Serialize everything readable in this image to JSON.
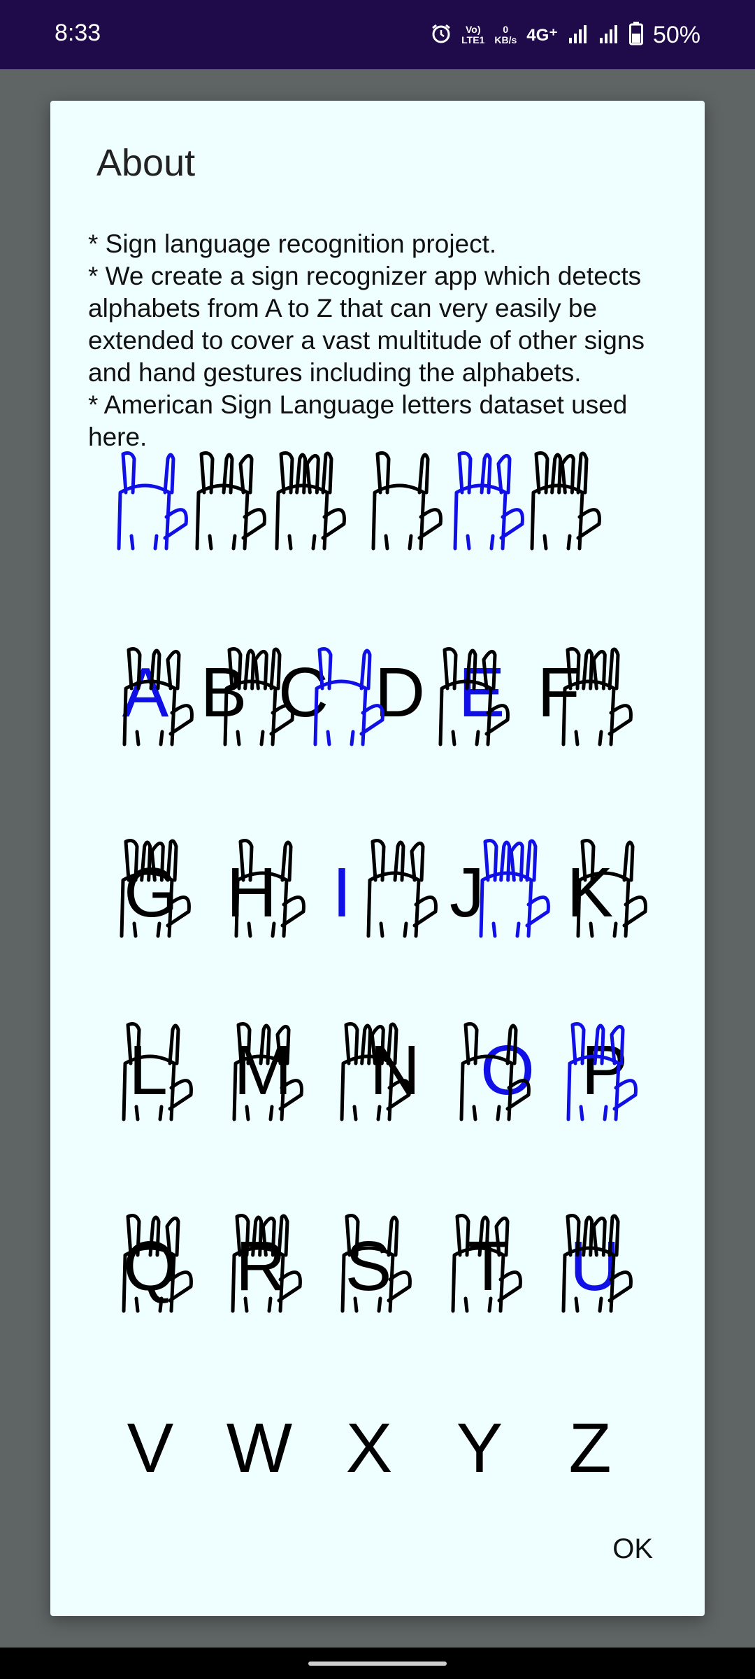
{
  "status_bar": {
    "time": "8:33",
    "icons": [
      "alarm-icon",
      "volte-icon",
      "data-speed-icon",
      "4g-icon",
      "signal-icon",
      "signal-icon",
      "battery-icon"
    ],
    "volte_line1": "Vo)",
    "volte_line2": "LTE1",
    "data_speed_value": "0",
    "data_speed_unit": "KB/s",
    "network": "4G⁺",
    "battery": "50%"
  },
  "dialog": {
    "title": "About",
    "body_lines": [
      "* Sign language recognition project.",
      "* We create a sign recognizer app which detects alphabets from A to Z that can very easily be extended to cover a vast multitude of other signs and hand gestures including the alphabets.",
      "* American Sign Language letters dataset used here."
    ],
    "ok_label": "OK"
  },
  "asl_chart": {
    "highlight_color": "#1010e6",
    "base_color": "#000000",
    "rows": [
      [
        {
          "letter": "A",
          "blue": true
        },
        {
          "letter": "B",
          "blue": false
        },
        {
          "letter": "C",
          "blue": false
        },
        {
          "letter": "D",
          "blue": false
        },
        {
          "letter": "E",
          "blue": true
        },
        {
          "letter": "F",
          "blue": false
        }
      ],
      [
        {
          "letter": "G",
          "blue": false
        },
        {
          "letter": "H",
          "blue": false
        },
        {
          "letter": "I",
          "blue": true
        },
        {
          "letter": "J",
          "blue": false
        },
        {
          "letter": "K",
          "blue": false
        }
      ],
      [
        {
          "letter": "L",
          "blue": false
        },
        {
          "letter": "M",
          "blue": false
        },
        {
          "letter": "N",
          "blue": false
        },
        {
          "letter": "O",
          "blue": true
        },
        {
          "letter": "P",
          "blue": false
        }
      ],
      [
        {
          "letter": "Q",
          "blue": false
        },
        {
          "letter": "R",
          "blue": false
        },
        {
          "letter": "S",
          "blue": false
        },
        {
          "letter": "T",
          "blue": false
        },
        {
          "letter": "U",
          "blue": true
        }
      ],
      [
        {
          "letter": "V",
          "blue": false
        },
        {
          "letter": "W",
          "blue": false
        },
        {
          "letter": "X",
          "blue": false
        },
        {
          "letter": "Y",
          "blue": false
        },
        {
          "letter": "Z",
          "blue": false
        }
      ]
    ]
  },
  "colors": {
    "status_bar_bg": "#1f0a4a",
    "scrim": "#5f6464",
    "dialog_bg": "#efffff"
  }
}
